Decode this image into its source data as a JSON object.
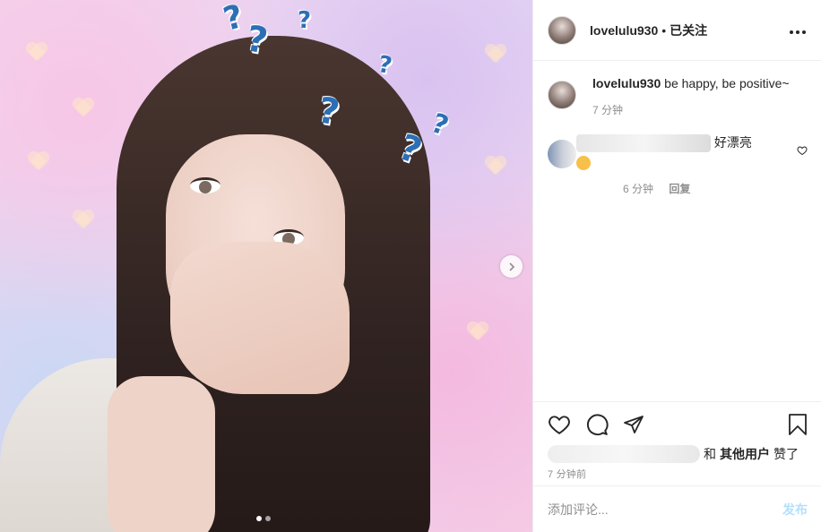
{
  "post": {
    "username": "lovelulu930",
    "follow_status": "已关注",
    "separator": "•",
    "more_icon": "more-horizontal-icon",
    "caption": {
      "username": "lovelulu930",
      "text": "be happy, be positive~",
      "time": "7 分钟"
    },
    "comments": [
      {
        "text": "好漂亮",
        "time": "6 分钟",
        "reply_label": "回复"
      }
    ],
    "likes": {
      "connector": "和",
      "others_label": "其他用户",
      "suffix": "赞了"
    },
    "timestamp": "7 分钟前",
    "add_comment": {
      "placeholder": "添加评论...",
      "post_label": "发布"
    },
    "carousel": {
      "total": 2,
      "active_index": 0
    }
  },
  "colors": {
    "link_disabled": "#b2dffc",
    "secondary_text": "#8e8e8e",
    "border": "#efefef",
    "question_mark": "#2c6fb5"
  }
}
